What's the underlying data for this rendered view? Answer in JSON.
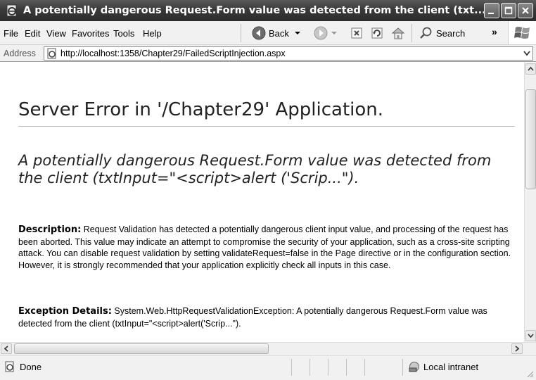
{
  "window": {
    "title": "A potentially dangerous Request.Form value was detected from the client (txt..."
  },
  "menu": {
    "file": "File",
    "edit": "Edit",
    "view": "View",
    "favorites": "Favorites",
    "tools": "Tools",
    "help": "Help"
  },
  "toolbar": {
    "back_label": "Back",
    "search_label": "Search",
    "overflow": "»"
  },
  "address": {
    "label": "Address",
    "url": "http://localhost:1358/Chapter29/FailedScriptInjection.aspx"
  },
  "page": {
    "heading": "Server Error in '/Chapter29' Application.",
    "message": "A potentially dangerous Request.Form value was detected from the client (txtInput=\"<script>alert ('Scrip...\").",
    "description_label": "Description:",
    "description_text": " Request Validation has detected a potentially dangerous client input value, and processing of the request has been aborted. This value may indicate an attempt to compromise the security of your application, such as a cross-site scripting attack. You can disable request validation by setting validateRequest=false in the Page directive or in the configuration section. However, it is strongly recommended that your application explicitly check all inputs in this case.",
    "exception_label": "Exception Details:",
    "exception_text": " System.Web.HttpRequestValidationException: A potentially dangerous Request.Form value was detected from the client (txtInput=\"<script>alert('Scrip...\")."
  },
  "status": {
    "text": "Done",
    "zone": "Local intranet"
  },
  "icons": {
    "title": "ie-page-icon",
    "back": "back-arrow-icon",
    "forward": "forward-arrow-icon",
    "stop": "stop-icon",
    "refresh": "refresh-icon",
    "home": "home-icon",
    "search": "search-icon",
    "zone": "intranet-icon",
    "windows_logo": "windows-flag-icon"
  }
}
